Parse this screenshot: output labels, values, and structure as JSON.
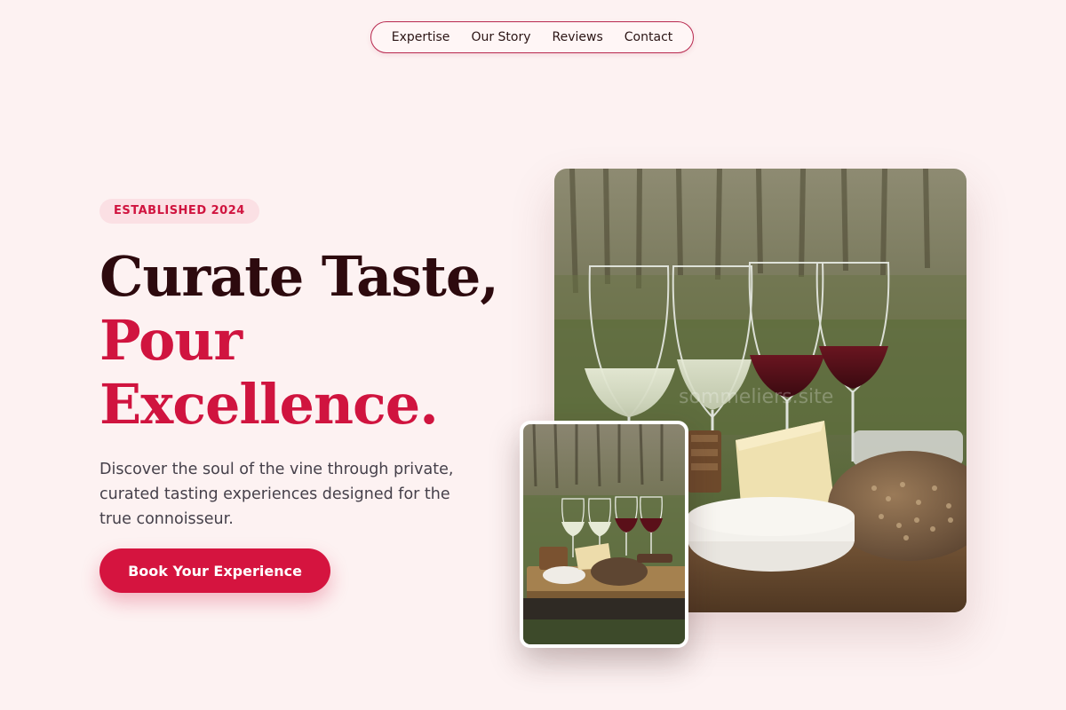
{
  "nav": {
    "items": [
      {
        "label": "Expertise"
      },
      {
        "label": "Our Story"
      },
      {
        "label": "Reviews"
      },
      {
        "label": "Contact"
      }
    ]
  },
  "hero": {
    "badge": "ESTABLISHED 2024",
    "headline_line1": "Curate Taste,",
    "headline_line2": "Pour",
    "headline_line3": "Excellence.",
    "description": "Discover the soul of the vine through private, curated tasting experiences designed for the true connoisseur.",
    "cta_label": "Book Your Experience"
  },
  "images": {
    "main_watermark": "sommeliers.site"
  },
  "colors": {
    "background": "#fdf2f2",
    "accent": "#d5143f",
    "headline_dark": "#2d0a0e",
    "badge_bg": "#fbe0e4"
  }
}
